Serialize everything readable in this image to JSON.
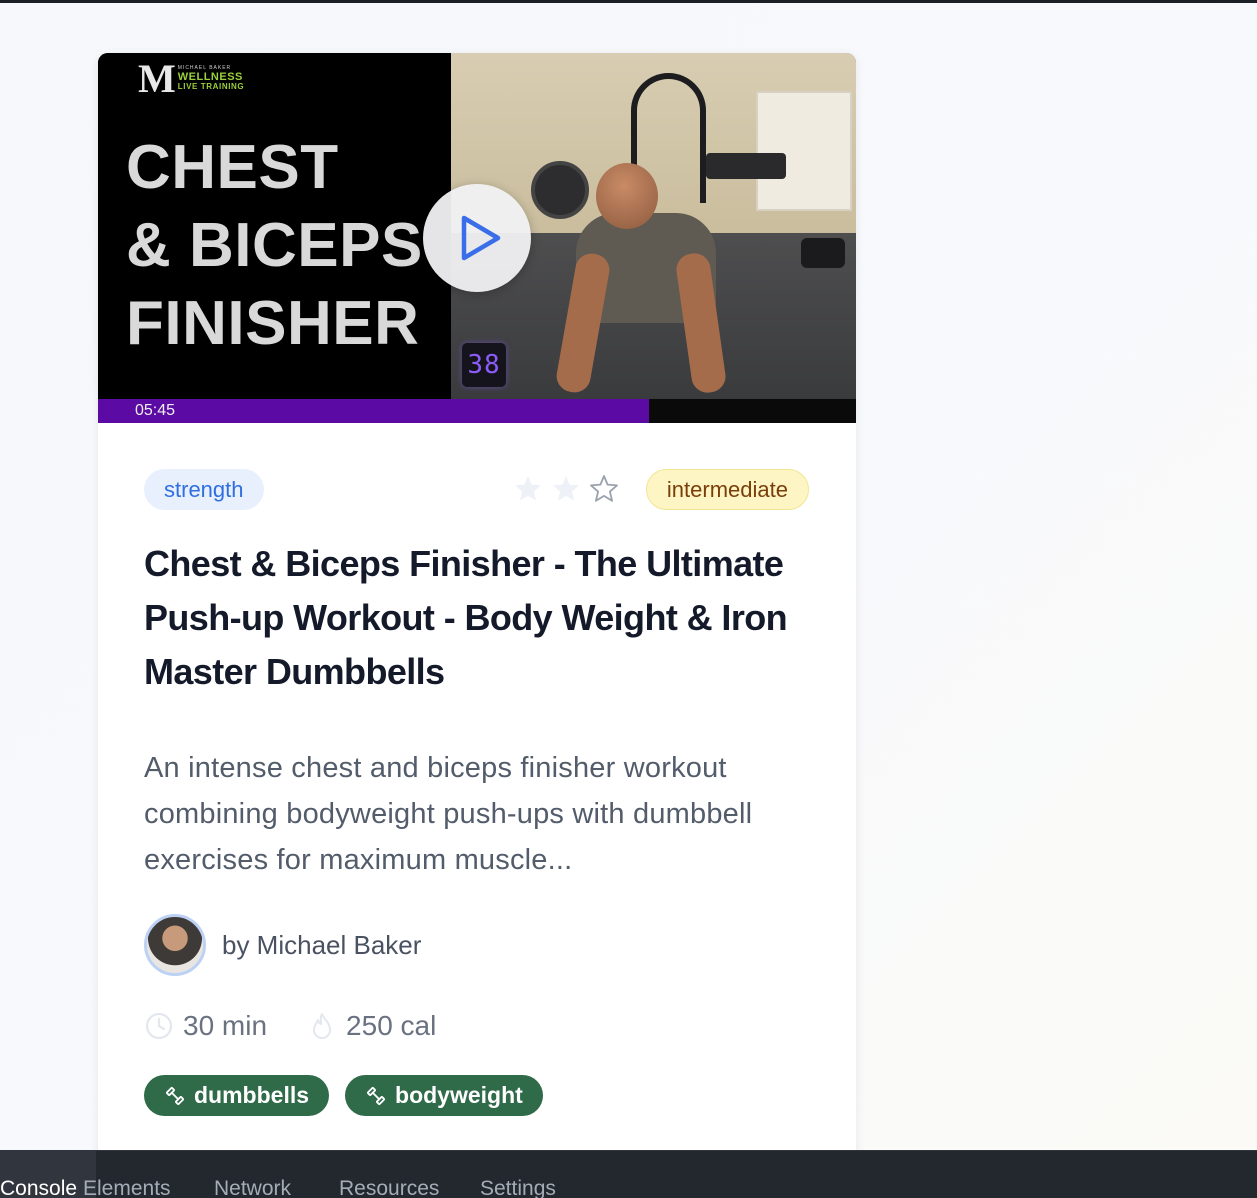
{
  "video": {
    "overlay_title_lines": [
      "CHEST",
      "& BICEPS",
      "FINISHER"
    ],
    "logo": {
      "letter": "M",
      "line1": "MICHAEL BAKER",
      "line2": "WELLNESS",
      "line3": "LIVE TRAINING"
    },
    "rep_counter": "38",
    "elapsed_time": "05:45",
    "progress_fraction": 0.727
  },
  "card": {
    "category": "strength",
    "rating": {
      "filled": 2,
      "total": 3
    },
    "difficulty": "intermediate",
    "title": "Chest & Biceps Finisher - The Ultimate Push-up Workout - Body Weight & Iron Master Dumbbells",
    "description": "An intense chest and biceps finisher workout combining bodyweight push-ups with dumbbell exercises for maximum muscle...",
    "author": "by Michael Baker",
    "duration": "30 min",
    "calories": "250 cal",
    "equipment": [
      "dumbbells",
      "bodyweight"
    ]
  },
  "devtools": {
    "tabs": [
      {
        "label": "Console",
        "active": true
      },
      {
        "label": "Elements",
        "active": false
      },
      {
        "label": "Network",
        "active": false
      },
      {
        "label": "Resources",
        "active": false
      },
      {
        "label": "Settings",
        "active": false
      }
    ]
  },
  "colors": {
    "accent_blue": "#2f6fe0",
    "progress_purple": "#5b0aa3",
    "tag_green": "#2f6a49",
    "level_yellow": "#fdf6c4",
    "star_empty": "#eef1f7"
  },
  "icons": [
    "play-icon",
    "star-icon",
    "clock-icon",
    "flame-icon",
    "dumbbell-icon"
  ]
}
